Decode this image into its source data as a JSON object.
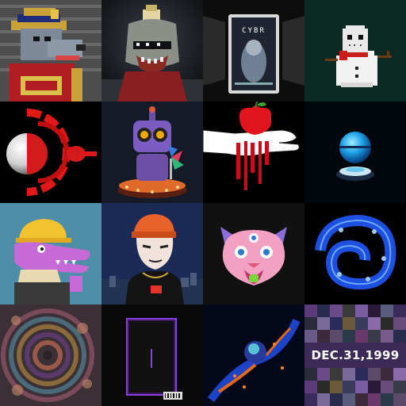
{
  "gallery": {
    "tiles": [
      {
        "name": "pixel-pharaoh-wolf",
        "bg": "#555555"
      },
      {
        "name": "robot-zombie-with-pixel-glasses",
        "bg": "#1c1f24"
      },
      {
        "name": "cybr-card",
        "bg": "#0d0d0d",
        "text": "CYBR"
      },
      {
        "name": "pixel-snowman-with-hockey-mask",
        "bg": "#0b2a23"
      },
      {
        "name": "red-orb-eye",
        "bg": "#000000"
      },
      {
        "name": "toy-robot-with-pinwheel",
        "bg": "#141a26"
      },
      {
        "name": "hand-holding-bleeding-apple",
        "bg": "#000000"
      },
      {
        "name": "blue-glass-orb-on-pedestal",
        "bg": "#02060d"
      },
      {
        "name": "purple-crocodile-with-hard-hat",
        "bg": "#4f8ea8"
      },
      {
        "name": "orange-beanie-vampire-guy",
        "bg": "#1b2a56"
      },
      {
        "name": "three-eyed-pink-cat",
        "bg": "#111111"
      },
      {
        "name": "blue-neon-swirl",
        "bg": "#000000"
      },
      {
        "name": "psychedelic-fractal",
        "bg": "#3b3036"
      },
      {
        "name": "neon-card-frame",
        "bg": "#0a0a0a"
      },
      {
        "name": "blue-orange-spectral-figure",
        "bg": "#05071a"
      },
      {
        "name": "dec-1999-pixel-mosaic",
        "bg": "#3a2a55",
        "text": "DEC.31,1999"
      }
    ]
  }
}
